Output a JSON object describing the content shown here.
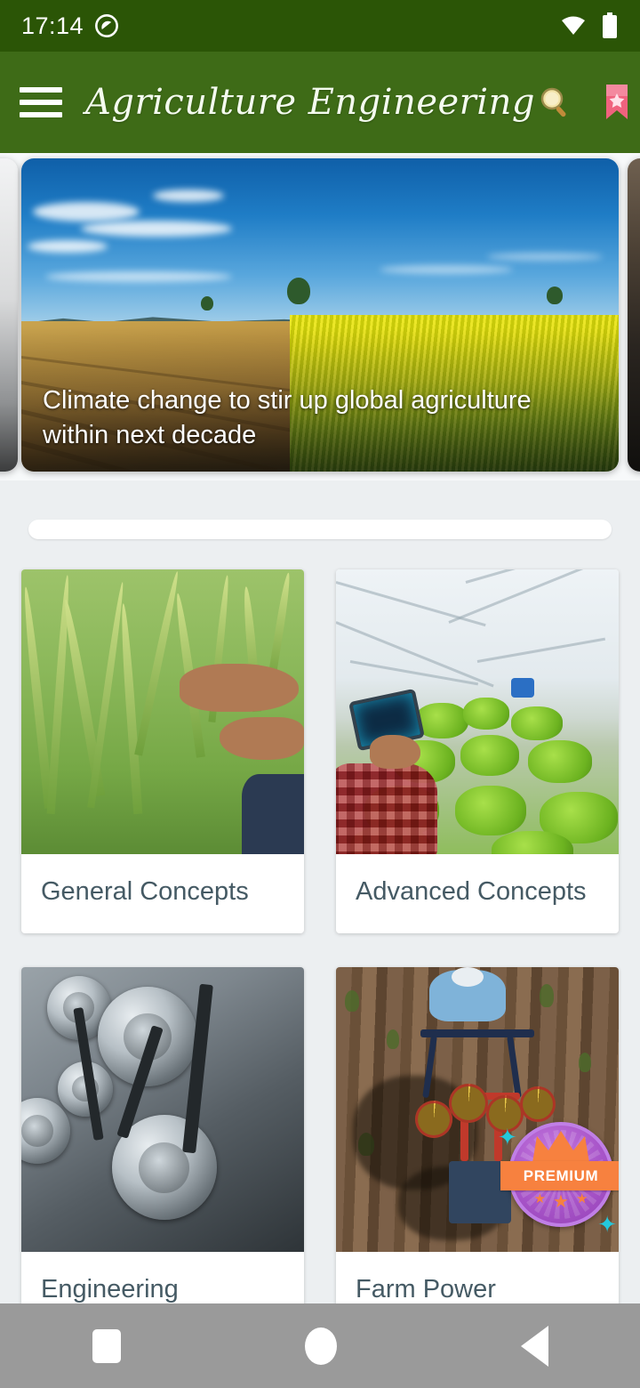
{
  "status_bar": {
    "time": "17:14",
    "icons": [
      "do-not-disturb-icon",
      "wifi-icon",
      "battery-icon"
    ],
    "background_color": "#2b5506"
  },
  "app_bar": {
    "menu_icon": "hamburger-menu-icon",
    "title": "Agriculture Engineering",
    "background_color": "#3e6b17",
    "actions": [
      {
        "name": "search-icon",
        "glyph": "🔍"
      },
      {
        "name": "bookmark-icon",
        "glyph": "🔖"
      },
      {
        "name": "notifications-icon",
        "glyph": "🔔"
      }
    ]
  },
  "carousel": {
    "active_index": 1,
    "slides": [
      {
        "title": "",
        "kind": "gray-placeholder"
      },
      {
        "title": "Climate change to stir up global agriculture within next decade",
        "kind": "field-photo"
      },
      {
        "title": "",
        "kind": "soil-photo"
      }
    ]
  },
  "search": {
    "value": "",
    "placeholder": ""
  },
  "categories": [
    {
      "label": "General Concepts",
      "image": "rice-crop-hands-photo",
      "premium": false
    },
    {
      "label": "Advanced Concepts",
      "image": "greenhouse-hydroponics-tablet-photo",
      "premium": false
    },
    {
      "label": "Engineering",
      "image": "engine-pulleys-photo",
      "premium": false
    },
    {
      "label": "Farm Power",
      "image": "farmer-power-tiller-photo",
      "premium": true
    }
  ],
  "premium_badge": {
    "label": "PREMIUM",
    "banner_color": "#f7813f",
    "circle_color": "#a855c9",
    "star_glyph": "★",
    "sparkle_glyph": "✦"
  },
  "nav_bar": {
    "background_color": "#9a9a9a",
    "buttons": [
      {
        "name": "recents-button",
        "shape": "square"
      },
      {
        "name": "home-button",
        "shape": "circle"
      },
      {
        "name": "back-button",
        "shape": "triangle"
      }
    ]
  },
  "theme": {
    "page_background": "#eceff1",
    "card_background": "#ffffff",
    "label_color": "#455a64"
  }
}
